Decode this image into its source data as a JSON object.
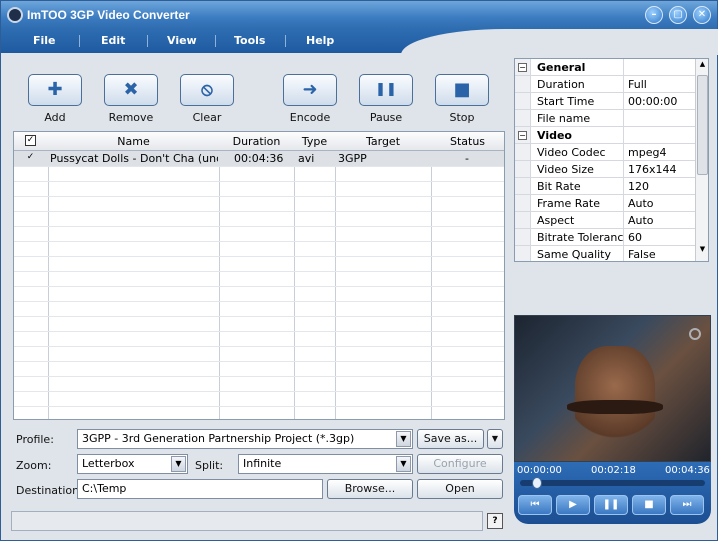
{
  "window": {
    "title": "ImTOO 3GP Video Converter",
    "buttons": {
      "minimize": "–",
      "maximize": "▢",
      "close": "✕"
    }
  },
  "menu": [
    "File",
    "Edit",
    "View",
    "Tools",
    "Help"
  ],
  "toolbar": [
    {
      "label": "Add",
      "glyph": "✚"
    },
    {
      "label": "Remove",
      "glyph": "✖"
    },
    {
      "label": "Clear",
      "glyph": "⦸"
    },
    {
      "label": "Encode",
      "glyph": "➜"
    },
    {
      "label": "Pause",
      "glyph": "❚❚"
    },
    {
      "label": "Stop",
      "glyph": "■"
    }
  ],
  "list": {
    "columns": [
      "Name",
      "Duration",
      "Type",
      "Target",
      "Status"
    ],
    "header_check": "✓",
    "rows": [
      {
        "checked": "✓",
        "name": "Pussycat Dolls - Don't Cha (uncensored)",
        "duration": "00:04:36",
        "type": "avi",
        "target": "3GPP",
        "status": "-"
      }
    ]
  },
  "form": {
    "profile_label": "Profile:",
    "profile_value": "3GPP - 3rd Generation Partnership Project  (*.3gp)",
    "save_as": "Save as...",
    "zoom_label": "Zoom:",
    "zoom_value": "Letterbox",
    "split_label": "Split:",
    "split_value": "Infinite",
    "configure": "Configure",
    "destination_label": "Destination:",
    "destination_value": "C:\\Temp",
    "browse": "Browse...",
    "open": "Open"
  },
  "properties": [
    {
      "group": true,
      "key": "General",
      "pm": "−"
    },
    {
      "key": "Duration",
      "value": "Full"
    },
    {
      "key": "Start Time",
      "value": "00:00:00"
    },
    {
      "key": "File name",
      "value": ""
    },
    {
      "group": true,
      "key": "Video",
      "pm": "−"
    },
    {
      "key": "Video Codec",
      "value": "mpeg4"
    },
    {
      "key": "Video Size",
      "value": "176x144"
    },
    {
      "key": "Bit Rate",
      "value": "120"
    },
    {
      "key": "Frame Rate",
      "value": "Auto"
    },
    {
      "key": "Aspect",
      "value": "Auto"
    },
    {
      "key": "Bitrate Tolerance",
      "value": "60"
    },
    {
      "key": "Same Quality",
      "value": "False"
    }
  ],
  "player": {
    "time_start": "00:00:00",
    "time_current": "00:02:18",
    "time_end": "00:04:36",
    "progress": 0.07,
    "controls": [
      "⏮",
      "▶",
      "❚❚",
      "■",
      "⏭"
    ]
  },
  "status": {
    "help": "?"
  },
  "colors": {
    "title_bar": "#3b7bc0",
    "menu_bar": "#1f5aa0",
    "accent": "#2a63a8"
  }
}
